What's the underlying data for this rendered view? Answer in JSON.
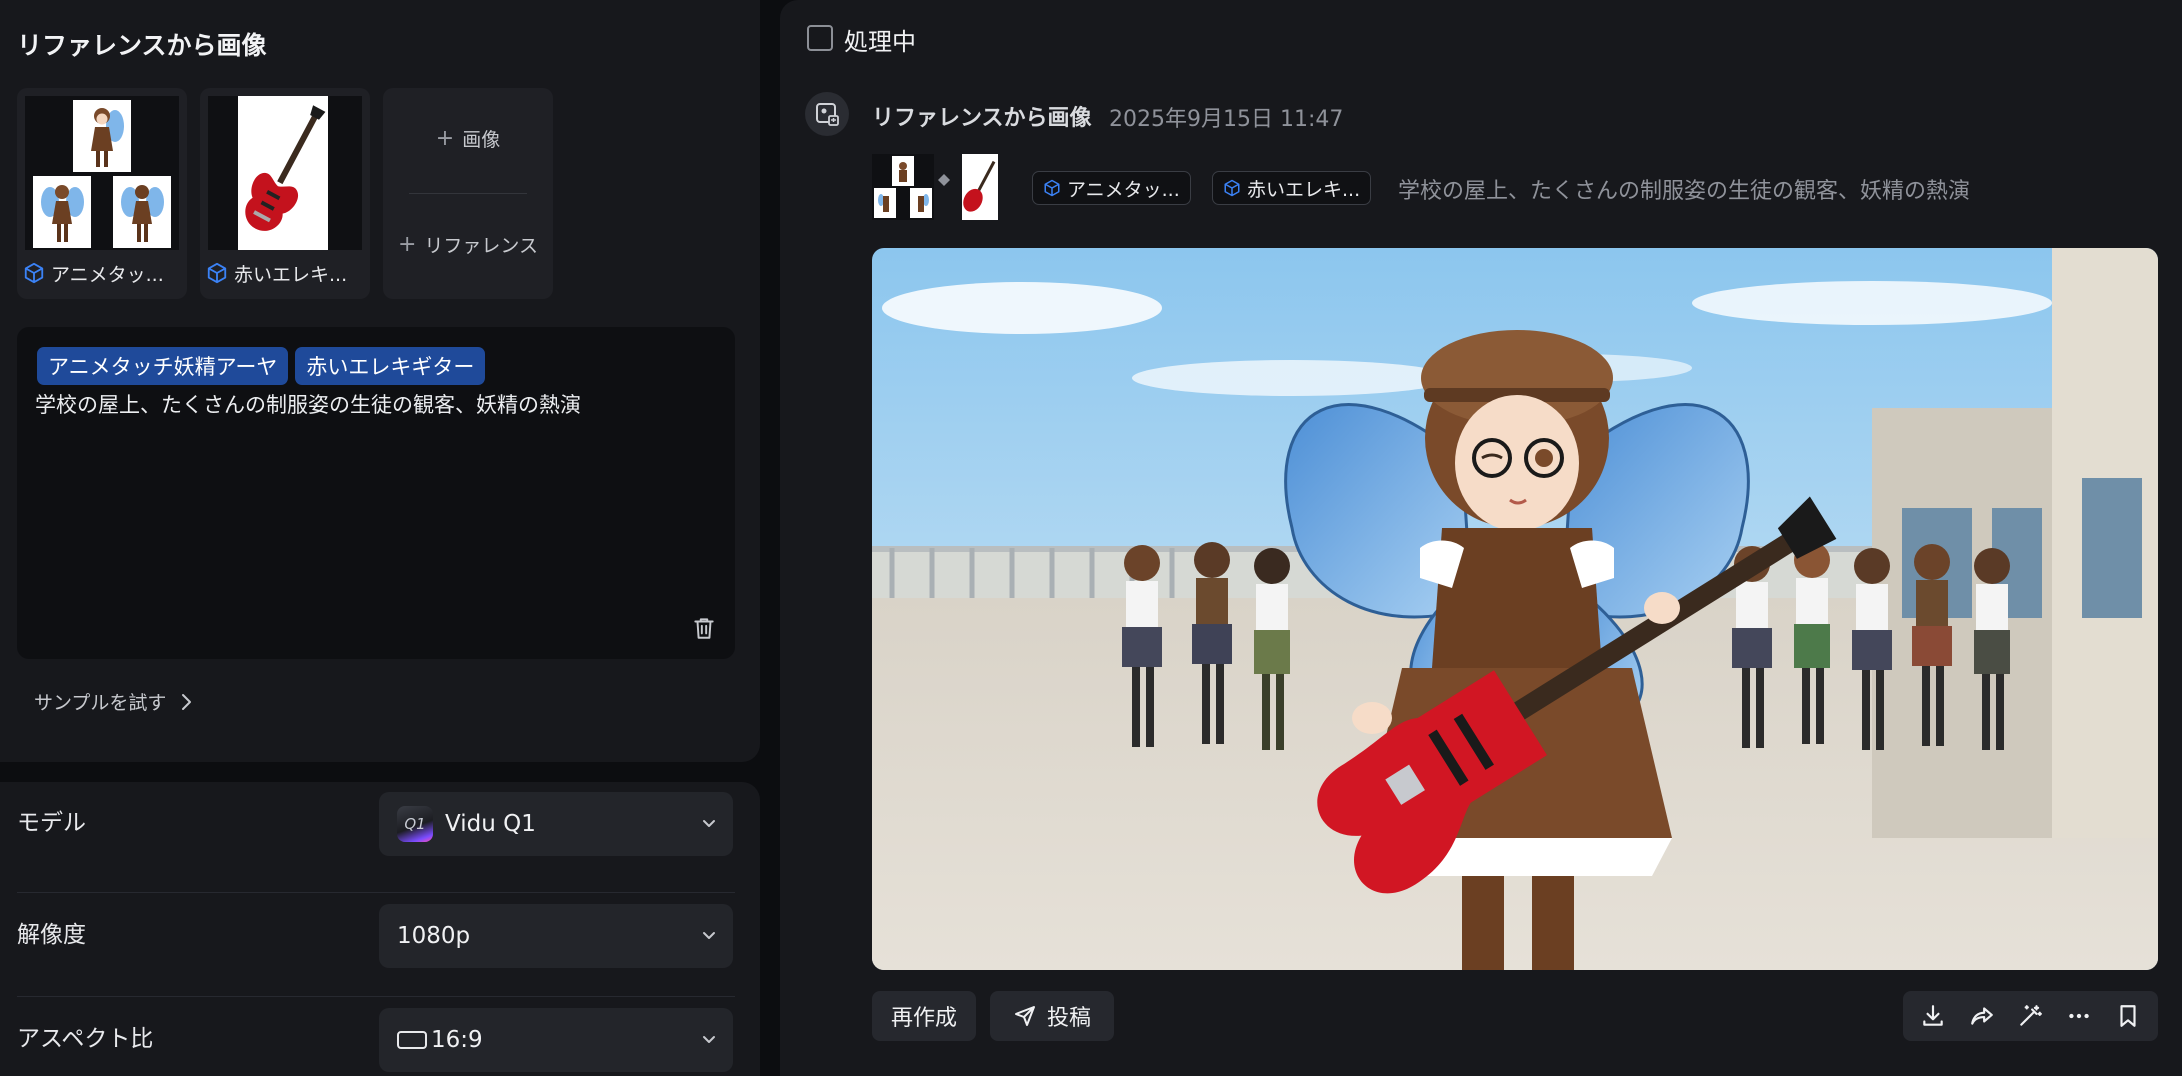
{
  "reference_panel": {
    "title": "リファレンスから画像",
    "references": [
      {
        "label": "アニメタッ..."
      },
      {
        "label": "赤いエレキ..."
      }
    ],
    "add_image_label": "画像",
    "add_reference_label": "リファレンス",
    "prompt": {
      "tags": [
        "アニメタッチ妖精アーヤ",
        "赤いエレキギター"
      ],
      "text": "学校の屋上、たくさんの制服姿の生徒の観客、妖精の熱演"
    },
    "sample_link": "サンプルを試す"
  },
  "settings": {
    "model": {
      "label": "モデル",
      "value": "Vidu Q1",
      "logo_text": "Q1"
    },
    "resolution": {
      "label": "解像度",
      "value": "1080p"
    },
    "aspect_ratio": {
      "label": "アスペクト比",
      "value": "16:9"
    }
  },
  "task_panel": {
    "processing_label": "処理中",
    "task": {
      "title": "リファレンスから画像",
      "timestamp": "2025年9月15日 11:47",
      "chips": [
        "アニメタッ...",
        "赤いエレキ..."
      ],
      "prompt": "学校の屋上、たくさんの制服姿の生徒の観客、妖精の熱演"
    },
    "actions": {
      "recreate": "再作成",
      "post": "投稿"
    },
    "tools": [
      "download-icon",
      "share-icon",
      "magic-edit-icon",
      "more-icon",
      "bookmark-icon"
    ]
  },
  "colors": {
    "panel_bg": "#17181c",
    "page_bg": "#0c0d10",
    "tag_bg": "#1f4a9a",
    "accent_blue": "#3b82f6"
  }
}
